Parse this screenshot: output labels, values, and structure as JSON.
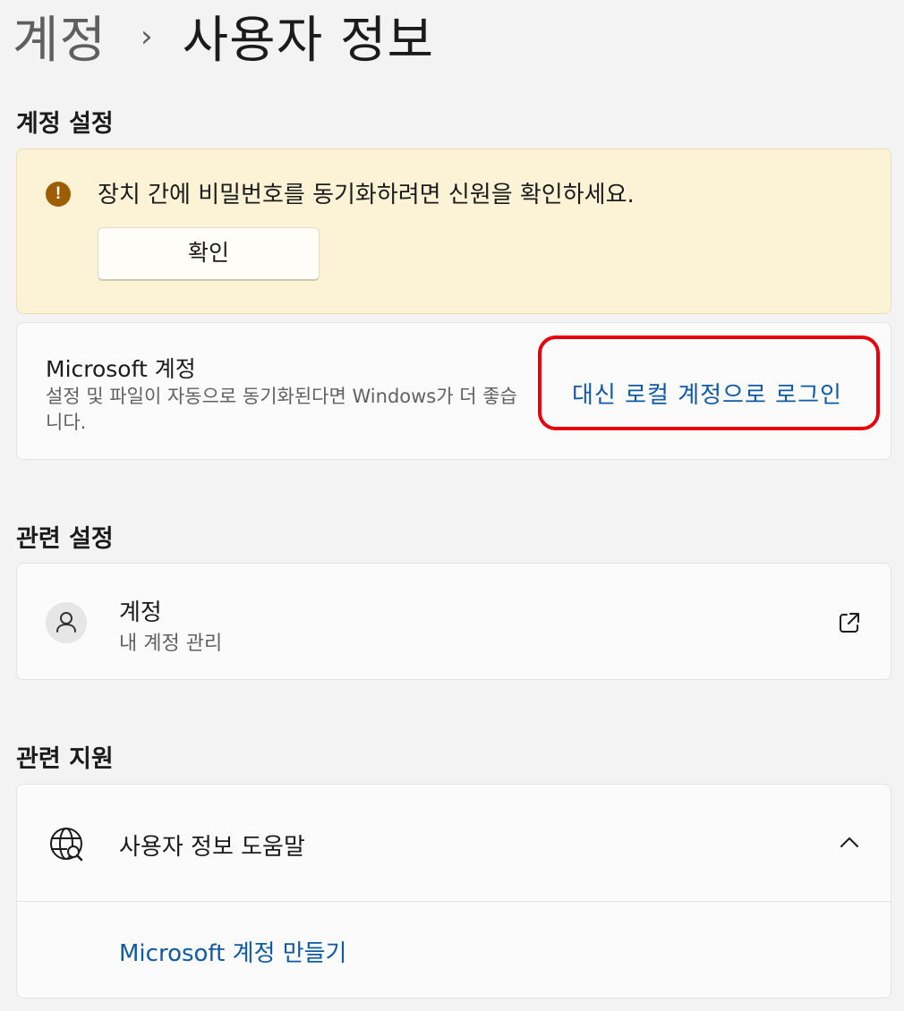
{
  "breadcrumb": {
    "parent": "계정",
    "separator": "›",
    "current": "사용자 정보"
  },
  "account_settings": {
    "heading": "계정 설정",
    "banner": {
      "icon": "warning-icon",
      "message": "장치 간에 비밀번호를 동기화하려면 신원을 확인하세요.",
      "button_label": "확인",
      "color": "#fcf3d6"
    },
    "microsoft_account": {
      "title": "Microsoft 계정",
      "description": "설정 및 파일이 자동으로 동기화된다면 Windows가 더 좋습니다.",
      "link_label": "대신 로컬 계정으로 로그인",
      "highlight_color": "#e8000b"
    }
  },
  "related_settings": {
    "heading": "관련 설정",
    "account_item": {
      "icon": "person-icon",
      "title": "계정",
      "subtitle": "내 계정 관리",
      "action_icon": "external-link-icon"
    }
  },
  "related_support": {
    "heading": "관련 지원",
    "help_item": {
      "icon": "globe-search-icon",
      "title": "사용자 정보 도움말",
      "expanded": true,
      "links": [
        "Microsoft 계정 만들기"
      ]
    }
  },
  "colors": {
    "link": "#0f5aa6",
    "warning_icon": "#9d5d00"
  }
}
